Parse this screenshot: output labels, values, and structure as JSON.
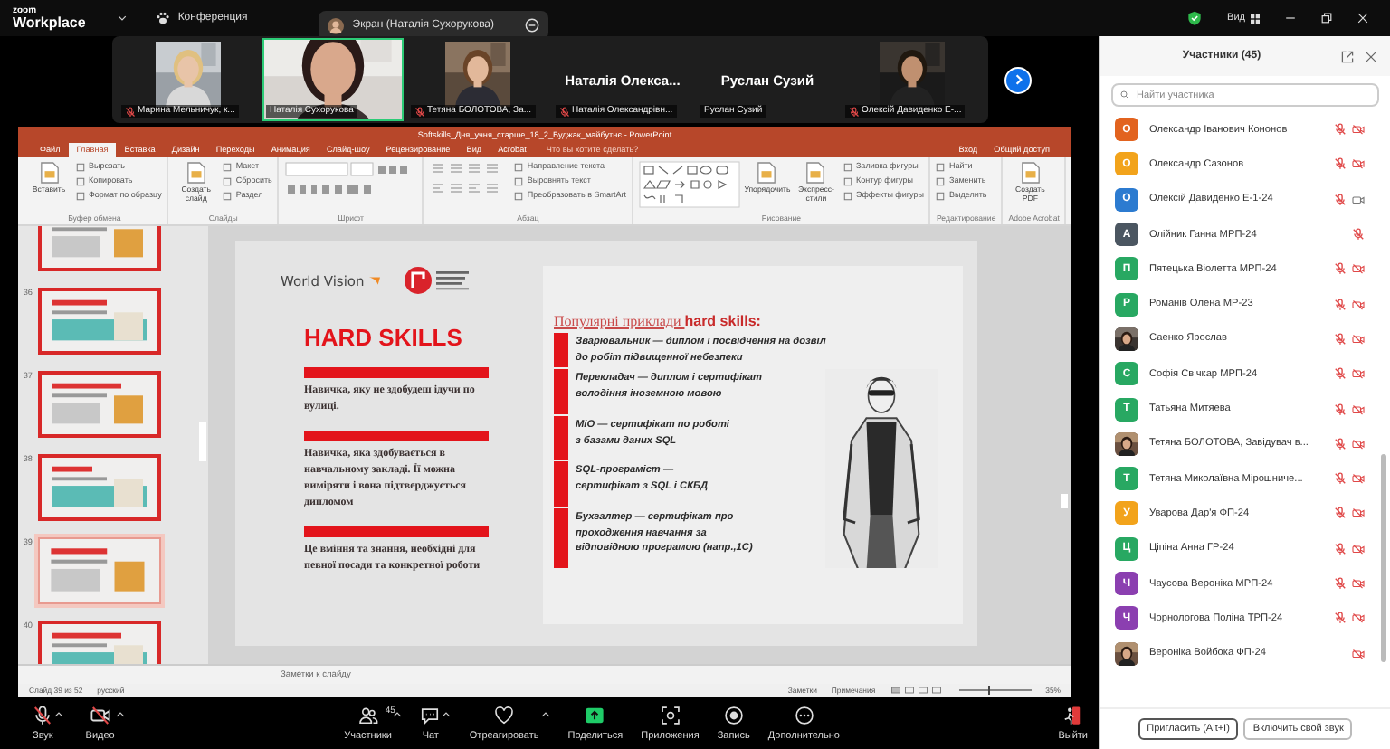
{
  "app_bar": {
    "logo_brand": "zoom",
    "logo_product": "Workplace",
    "meeting_menu": "Конференция",
    "share_banner": "Экран (Наталія Сухорукова)",
    "view_menu": "Вид"
  },
  "video_strip": {
    "tiles": [
      {
        "kind": "video",
        "name": "Марина Мельничук, к...",
        "mic_muted": true,
        "selected": false
      },
      {
        "kind": "video",
        "name": "Наталія Сухорукова",
        "mic_muted": false,
        "selected": true
      },
      {
        "kind": "video",
        "name": "Тетяна БОЛОТОВА, За...",
        "mic_muted": true,
        "selected": false
      },
      {
        "kind": "name",
        "display_name": "Наталія Олекса...",
        "name": "Наталія Олександрівн...",
        "mic_muted": true,
        "selected": false
      },
      {
        "kind": "name",
        "display_name": "Руслан Сузий",
        "name": "Руслан Сузий",
        "mic_muted": false,
        "selected": false
      },
      {
        "kind": "video",
        "name": "Олексій Давиденко Е-...",
        "mic_muted": true,
        "selected": false
      }
    ]
  },
  "powerpoint": {
    "title": "Softskills_Дня_учня_старше_18_2_Буджак_майбутнє - PowerPoint",
    "tabs": [
      {
        "label": "Файл",
        "selected": false
      },
      {
        "label": "Главная",
        "selected": true
      },
      {
        "label": "Вставка",
        "selected": false
      },
      {
        "label": "Дизайн",
        "selected": false
      },
      {
        "label": "Переходы",
        "selected": false
      },
      {
        "label": "Анимация",
        "selected": false
      },
      {
        "label": "Слайд-шоу",
        "selected": false
      },
      {
        "label": "Рецензирование",
        "selected": false
      },
      {
        "label": "Вид",
        "selected": false
      },
      {
        "label": "Acrobat",
        "selected": false
      }
    ],
    "tell_me": "Что вы хотите сделать?",
    "sign_in": "Вход",
    "share": "Общий доступ",
    "ribbon_groups": [
      {
        "kind": "clipboard",
        "label": "Буфер обмена",
        "commands": [
          {
            "kind": "large",
            "label": "Вставить"
          },
          {
            "kind": "small",
            "label": "Вырезать"
          },
          {
            "kind": "small",
            "label": "Копировать"
          },
          {
            "kind": "small",
            "label": "Формат по образцу"
          }
        ]
      },
      {
        "kind": "slides",
        "label": "Слайды",
        "commands": [
          {
            "kind": "large",
            "label": "Создать слайд"
          },
          {
            "kind": "small",
            "label": "Макет"
          },
          {
            "kind": "small",
            "label": "Сбросить"
          },
          {
            "kind": "small",
            "label": "Раздел"
          }
        ]
      },
      {
        "kind": "font",
        "label": "Шрифт"
      },
      {
        "kind": "paragraph",
        "label": "Абзац",
        "commands": [
          {
            "kind": "small",
            "label": "Направление текста"
          },
          {
            "kind": "small",
            "label": "Выровнять текст"
          },
          {
            "kind": "small",
            "label": "Преобразовать в SmartArt"
          }
        ]
      },
      {
        "kind": "drawing",
        "label": "Рисование",
        "commands": [
          {
            "kind": "large",
            "label": "Упорядочить"
          },
          {
            "kind": "large",
            "label": "Экспресс-стили"
          },
          {
            "kind": "small",
            "label": "Заливка фигуры"
          },
          {
            "kind": "small",
            "label": "Контур фигуры"
          },
          {
            "kind": "small",
            "label": "Эффекты фигуры"
          }
        ]
      },
      {
        "kind": "editing",
        "label": "Редактирование",
        "commands": [
          {
            "kind": "small",
            "label": "Найти"
          },
          {
            "kind": "small",
            "label": "Заменить"
          },
          {
            "kind": "small",
            "label": "Выделить"
          }
        ]
      },
      {
        "kind": "acrobat",
        "label": "Adobe Acrobat",
        "commands": [
          {
            "kind": "large",
            "label": "Создать PDF"
          }
        ]
      }
    ],
    "thumbnails": [
      {
        "selected": false
      },
      {
        "number": "36",
        "selected": false
      },
      {
        "number": "37",
        "selected": false
      },
      {
        "number": "38",
        "selected": false
      },
      {
        "number": "39",
        "selected": true
      },
      {
        "number": "40",
        "selected": false
      }
    ],
    "slide": {
      "logo_text": "World Vision",
      "title": "HARD SKILLS",
      "definitions": [
        "Навичка, яку не здобудеш ідучи по вулиці.",
        "Навичка, яка здобувається в навчальному закладі. Її можна виміряти і вона підтверджується дипломом",
        "Це вміння та знання, необхідні для певної посади та конкретної роботи"
      ],
      "examples_heading": "Популярні приклади **hard skills:**",
      "examples": [
        "Зварювальник — диплом і посвідчення на дозвіл\nдо робіт підвищенної небезпеки",
        "Перекладач — диплом і сертифікат\nволодіння іноземною мовою",
        "МіО — сертифікат по роботі\nз базами даних SQL",
        "SQL-програміст —\nсертифікат з SQL і СКБД",
        "Бухгалтер — сертифікат про\nпроходження навчання за\nвідповідною програмою (напр.,1С)"
      ]
    },
    "notes_placeholder": "Заметки к слайду",
    "status": {
      "slide_counter": "Слайд 39 из 52",
      "language": "русский",
      "notes": "Заметки",
      "comments": "Примечания",
      "zoom": "35%",
      "zoom_slider": {
        "level": 0.4
      }
    }
  },
  "toolbar": [
    {
      "kind": "audio",
      "label": "Звук",
      "muted": true,
      "caret": true
    },
    {
      "kind": "video",
      "label": "Видео",
      "muted": true,
      "caret": true
    },
    {
      "kind": "participants",
      "label": "Участники",
      "count": "45",
      "caret": true
    },
    {
      "kind": "chat",
      "label": "Чат",
      "caret": true
    },
    {
      "kind": "react",
      "label": "Отреагировать",
      "caret": true
    },
    {
      "kind": "share",
      "label": "Поделиться",
      "caret": false
    },
    {
      "kind": "apps",
      "label": "Приложения",
      "caret": false
    },
    {
      "kind": "record",
      "label": "Запись",
      "caret": false
    },
    {
      "kind": "more",
      "label": "Дополнительно",
      "caret": false
    },
    {
      "kind": "leave",
      "label": "Выйти",
      "caret": false
    }
  ],
  "participants_panel": {
    "title": "Участники (45)",
    "search_placeholder": "Найти участника",
    "participants": [
      {
        "name": "Олександр Іванович Кононов",
        "photo": false,
        "initial": "О",
        "color": "#e2631f",
        "mic_muted": true,
        "video_muted": true
      },
      {
        "name": "Олександр Сазонов",
        "photo": false,
        "initial": "О",
        "color": "#f2a31b",
        "mic_muted": true,
        "video_muted": true
      },
      {
        "name": "Олексій Давиденко Е-1-24",
        "photo": false,
        "initial": "О",
        "color": "#2c7bd0",
        "mic_muted": true,
        "video_muted": false
      },
      {
        "name": "Олійник Ганна МРП-24",
        "photo": false,
        "initial": "А",
        "color": "#4b5661",
        "mic_muted": true
      },
      {
        "name": "Пятецька Віолетта МРП-24",
        "photo": false,
        "initial": "П",
        "color": "#28a862",
        "mic_muted": true,
        "video_muted": true
      },
      {
        "name": "Романів Олена МР-23",
        "photo": false,
        "initial": "Р",
        "color": "#28a862",
        "mic_muted": true,
        "video_muted": true
      },
      {
        "name": "Саенко Ярослав",
        "photo": true,
        "mic_muted": true,
        "video_muted": true
      },
      {
        "name": "Софія Свічкар МРП-24",
        "photo": false,
        "initial": "С",
        "color": "#28a862",
        "mic_muted": true,
        "video_muted": true
      },
      {
        "name": "Татьяна Митяева",
        "photo": false,
        "initial": "Т",
        "color": "#28a862",
        "mic_muted": true,
        "video_muted": true
      },
      {
        "name": "Тетяна БОЛОТОВА, Завідувач в...",
        "photo": true,
        "mic_muted": true,
        "video_muted": true
      },
      {
        "name": "Тетяна Миколаївна Мірошниче...",
        "photo": false,
        "initial": "Т",
        "color": "#28a862",
        "mic_muted": true,
        "video_muted": true
      },
      {
        "name": "Уварова Дар'я ФП-24",
        "photo": false,
        "initial": "У",
        "color": "#f2a31b",
        "mic_muted": true,
        "video_muted": true
      },
      {
        "name": "Ціпіна Анна ГР-24",
        "photo": false,
        "initial": "Ц",
        "color": "#28a862",
        "mic_muted": true,
        "video_muted": true
      },
      {
        "name": "Чаусова Вероніка МРП-24",
        "photo": false,
        "initial": "Ч",
        "color": "#8b3fb0",
        "mic_muted": true,
        "video_muted": true
      },
      {
        "name": "Чорнологова Поліна ТРП-24",
        "photo": false,
        "initial": "Ч",
        "color": "#8b3fb0",
        "mic_muted": true,
        "video_muted": true
      },
      {
        "name": "Вероніка Войбока ФП-24",
        "photo": true,
        "mic_muted": false,
        "video_muted": true
      }
    ],
    "buttons": [
      "Пригласить (Alt+I)",
      "Включить свой звук"
    ]
  }
}
